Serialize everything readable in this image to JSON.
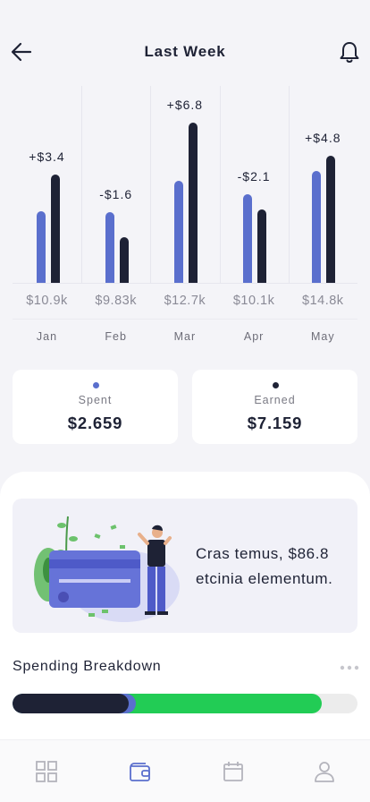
{
  "header": {
    "title": "Last Week",
    "back_icon": "arrow-left-icon",
    "bell_icon": "bell-icon"
  },
  "colors": {
    "spent": "#5a6fcd",
    "earned": "#1e2235",
    "savings": "#22cc55",
    "track": "#ececec"
  },
  "chart_data": {
    "type": "bar",
    "categories": [
      "Jan",
      "Feb",
      "Mar",
      "Apr",
      "May"
    ],
    "deltas": [
      "+$3.4",
      "-$1.6",
      "+$6.8",
      "-$2.1",
      "+$4.8"
    ],
    "totals": [
      "$10.9k",
      "$9.83k",
      "$12.7k",
      "$10.1k",
      "$14.8k"
    ],
    "series": [
      {
        "values": [
          4.0,
          3.95,
          5.7,
          4.95,
          6.25
        ]
      },
      {
        "values": [
          6.05,
          2.55,
          8.95,
          4.1,
          7.1
        ]
      }
    ],
    "ylim": [
      0,
      11
    ],
    "grid": true
  },
  "summary": {
    "spent": {
      "label": "Spent",
      "value": "$2.659"
    },
    "earned": {
      "label": "Earned",
      "value": "$7.159"
    }
  },
  "promo": {
    "text": "Cras temus, $86.8 etcinia elementum."
  },
  "breakdown": {
    "title": "Spending Breakdown",
    "segments": [
      {
        "color": "#5a6fcd",
        "fraction": 0.357
      },
      {
        "color": "#1e2235",
        "fraction": 0.337
      },
      {
        "color": "#22cc55",
        "fraction": 0.896
      }
    ]
  },
  "tabbar": {
    "tabs": [
      "grid-icon",
      "wallet-icon",
      "calendar-icon",
      "user-icon"
    ],
    "active": 1
  }
}
